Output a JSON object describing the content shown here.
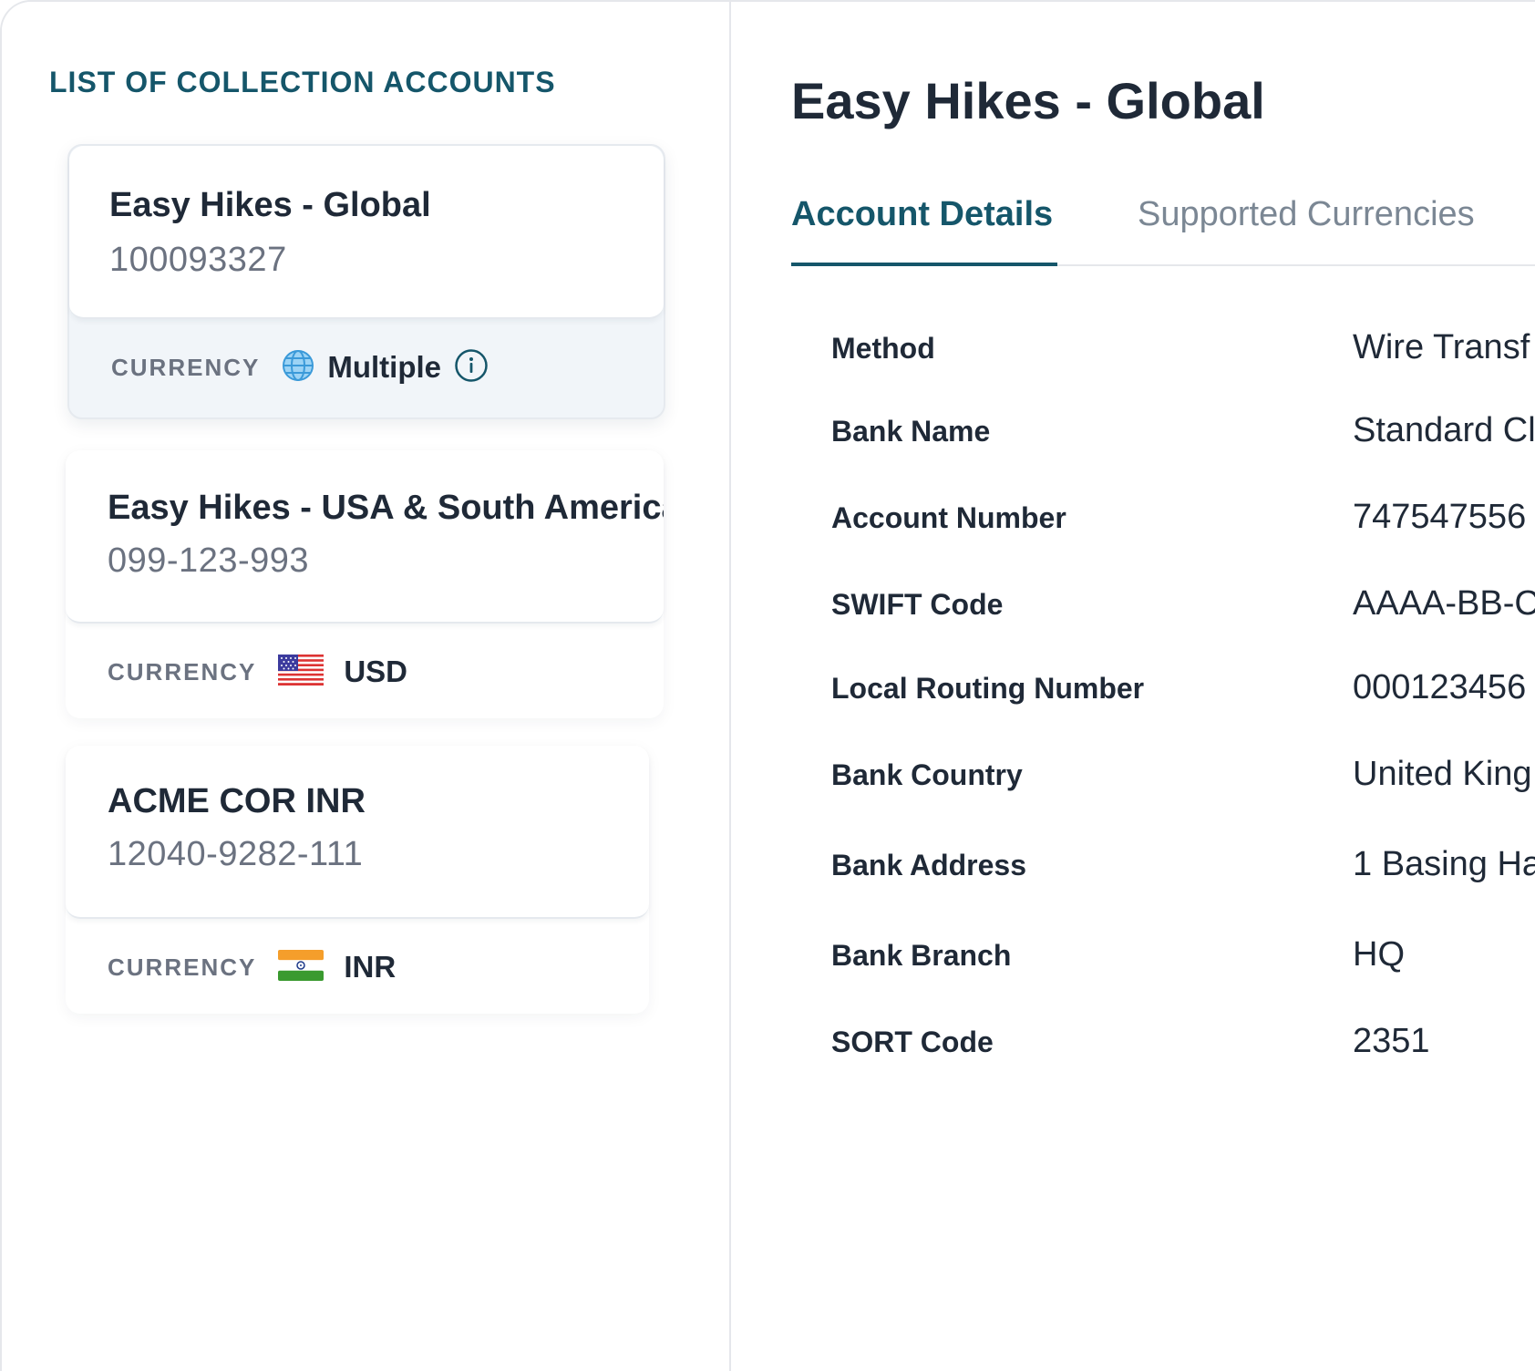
{
  "list": {
    "heading": "LIST OF COLLECTION ACCOUNTS",
    "accounts": [
      {
        "name": "Easy Hikes - Global",
        "number": "100093327",
        "currency_label": "CURRENCY",
        "currency": "Multiple",
        "currency_icon": "globe-icon"
      },
      {
        "name": "Easy Hikes - USA & South America",
        "number": "099-123-993",
        "currency_label": "CURRENCY",
        "currency": "USD",
        "currency_icon": "us-flag-icon"
      },
      {
        "name": "ACME COR INR",
        "number": "12040-9282-111",
        "currency_label": "CURRENCY",
        "currency": "INR",
        "currency_icon": "india-flag-icon"
      }
    ]
  },
  "detail": {
    "title": "Easy Hikes - Global",
    "tabs": [
      {
        "label": "Account Details",
        "active": true
      },
      {
        "label": "Supported Currencies",
        "active": false
      }
    ],
    "rows": [
      {
        "label": "Method",
        "value": "Wire Transf"
      },
      {
        "label": "Bank Name",
        "value": "Standard Cl"
      },
      {
        "label": "Account Number",
        "value": "747547556"
      },
      {
        "label": "SWIFT Code",
        "value": "AAAA-BB-C"
      },
      {
        "label": "Local Routing Number",
        "value": "000123456"
      },
      {
        "label": "Bank Country",
        "value": "United King"
      },
      {
        "label": "Bank Address",
        "value": "1 Basing Ha"
      },
      {
        "label": "Bank Branch",
        "value": "HQ"
      },
      {
        "label": "SORT Code",
        "value": "2351"
      }
    ]
  },
  "colors": {
    "accent": "#15566a",
    "text": "#1f2937",
    "muted": "#6b7280",
    "selected_bg": "#f1f5f9"
  }
}
